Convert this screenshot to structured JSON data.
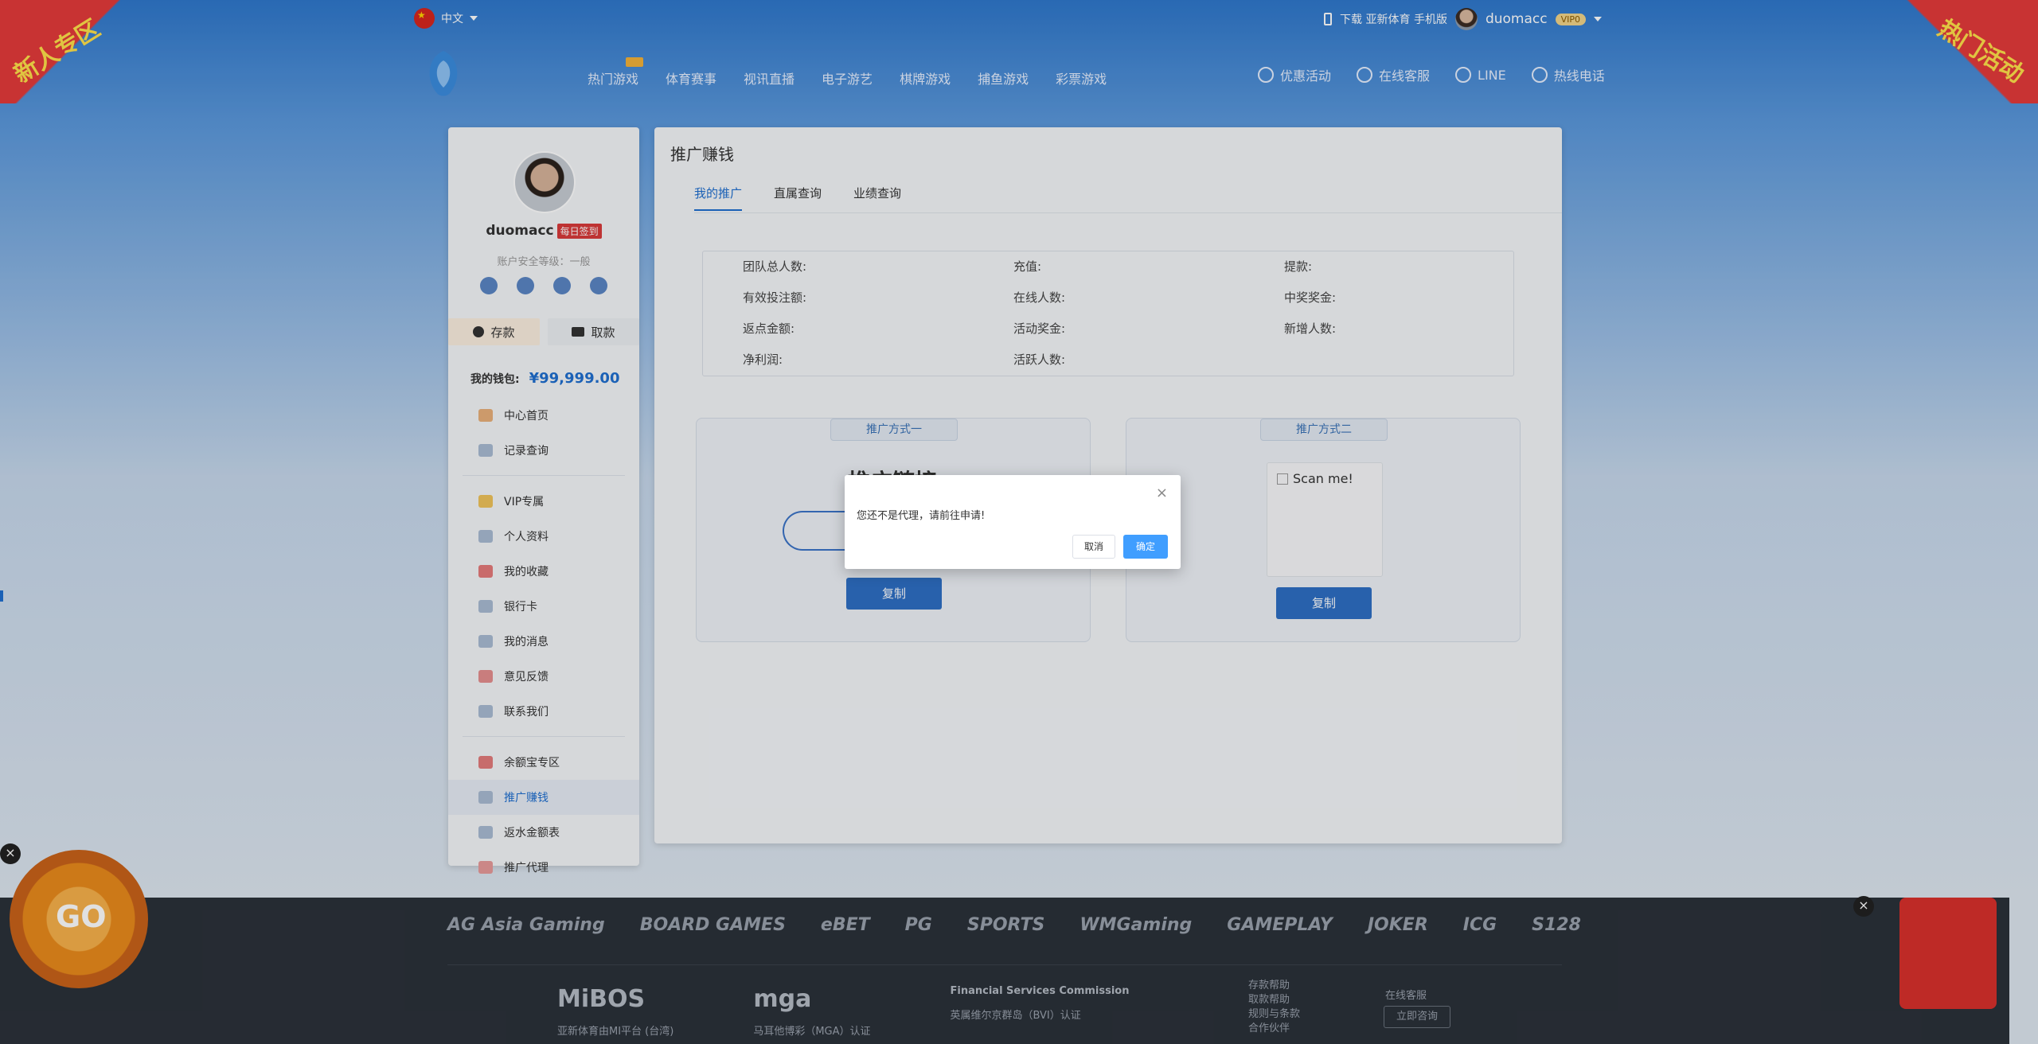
{
  "topbar": {
    "language": "中文",
    "download_text": "下载 亚新体育 手机版",
    "username": "duomacc",
    "vip_level": "VIP0"
  },
  "nav": {
    "items": [
      "热门游戏",
      "体育赛事",
      "视讯直播",
      "电子游艺",
      "棋牌游戏",
      "捕鱼游戏",
      "彩票游戏"
    ],
    "right": [
      "优惠活动",
      "在线客服",
      "LINE",
      "热线电话"
    ]
  },
  "profile": {
    "username": "duomacc",
    "checkin_badge": "每日签到",
    "security_level": "账户安全等级：一般",
    "deposit_label": "存款",
    "withdraw_label": "取款",
    "wallet_label": "我的钱包:",
    "wallet_amount": "¥99,999.00"
  },
  "menu": {
    "group1": [
      "中心首页",
      "记录查询"
    ],
    "group2": [
      "VIP专属",
      "个人资料",
      "我的收藏",
      "银行卡",
      "我的消息",
      "意见反馈",
      "联系我们"
    ],
    "group3": [
      "余额宝专区",
      "推广赚钱",
      "返水金额表",
      "推广代理"
    ],
    "active": "推广赚钱"
  },
  "main": {
    "title": "推广赚钱",
    "tabs": [
      "我的推广",
      "直属查询",
      "业绩查询"
    ],
    "stats": [
      [
        "团队总人数:",
        "充值:",
        "提款:"
      ],
      [
        "有效投注额:",
        "在线人数:",
        "中奖奖金:"
      ],
      [
        "返点金额:",
        "活动奖金:",
        "新增人数:"
      ],
      [
        "净利润:",
        "活跃人数:"
      ]
    ],
    "promo1": {
      "title": "推广方式一",
      "heading": "推广链接",
      "copy": "复制"
    },
    "promo2": {
      "title": "推广方式二",
      "qr_alt": "Scan me!",
      "copy": "复制"
    }
  },
  "modal": {
    "message": "您还不是代理，请前往申请!",
    "cancel": "取消",
    "confirm": "确定"
  },
  "footer": {
    "partners": [
      "AG Asia Gaming",
      "BOARD GAMES",
      "eBET",
      "PG",
      "SPORTS",
      "WMGaming",
      "GAMEPLAY",
      "JOKER",
      "ICG",
      "S128"
    ],
    "license1": {
      "logo": "MiBOS",
      "caption": "亚新体育由MI平台 (台湾)"
    },
    "license2": {
      "logo": "mga",
      "caption": "马耳他博彩（MGA）认证"
    },
    "license3": {
      "logo": "Financial Services Commission",
      "caption": "英属维尔京群岛（BVI）认证"
    },
    "links": [
      "存款帮助",
      "取款帮助",
      "规则与条款",
      "合作伙伴"
    ],
    "cs_label": "在线客服",
    "cs_button": "立即咨询"
  },
  "floating": {
    "left_banner": "新人专区",
    "right_banner": "热门活动",
    "wheel": "GO"
  }
}
